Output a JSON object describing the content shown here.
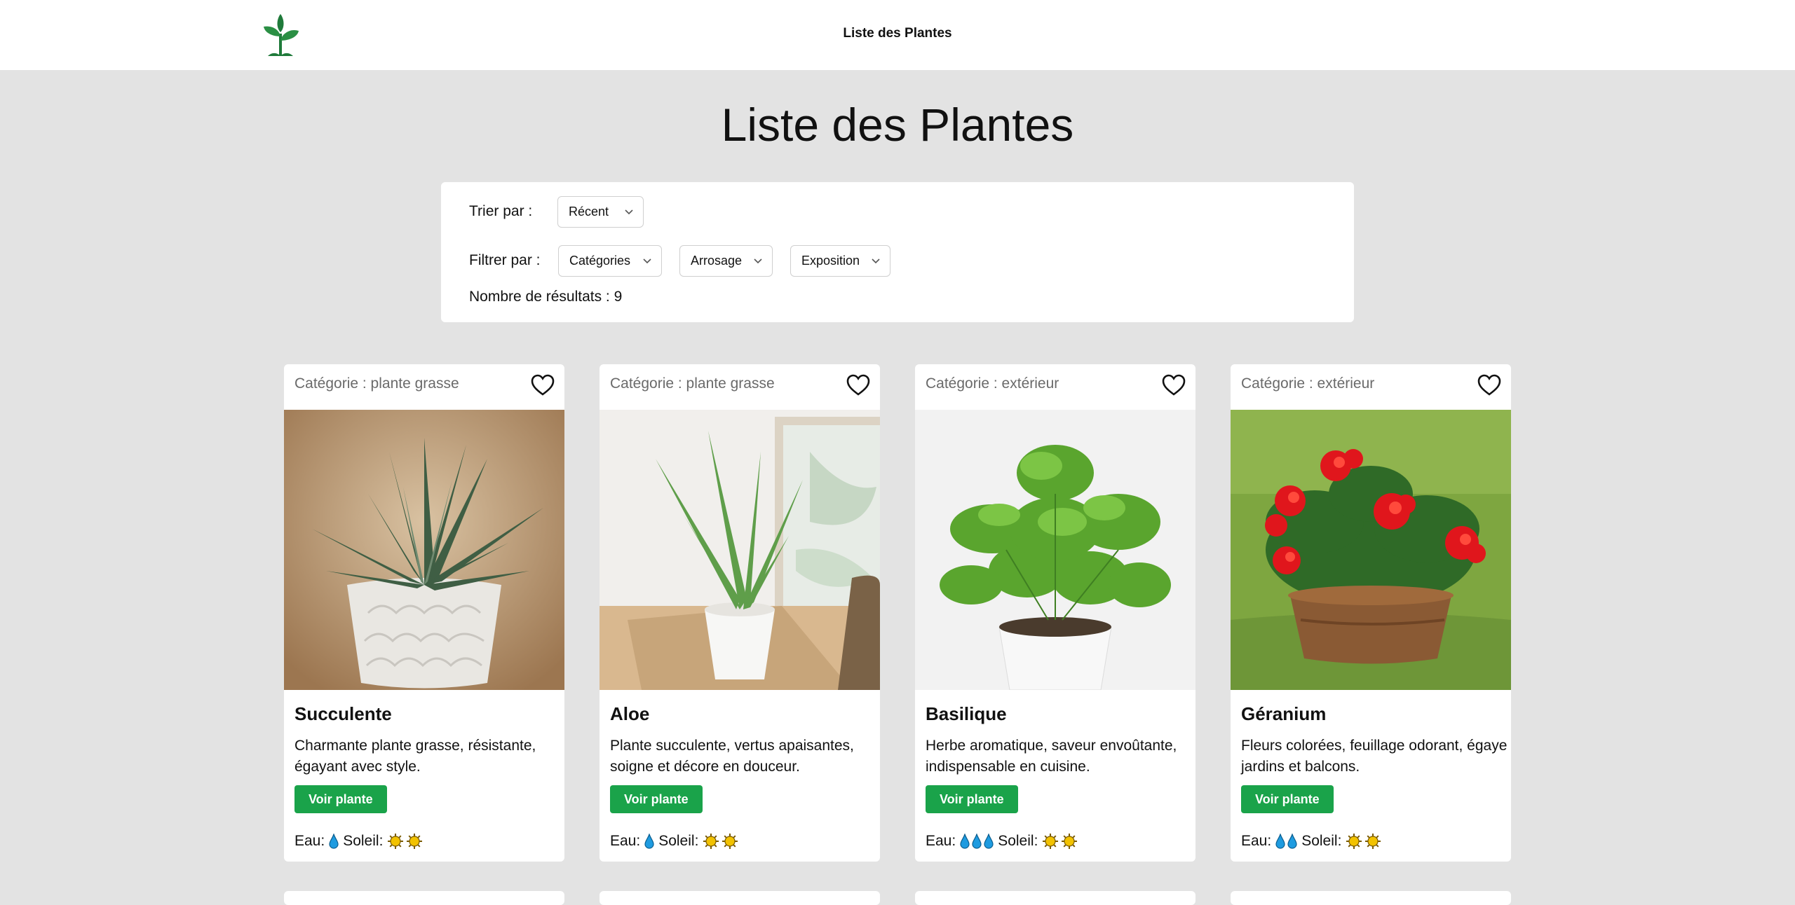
{
  "nav": {
    "link": "Liste des Plantes"
  },
  "page": {
    "title": "Liste des Plantes"
  },
  "filters": {
    "sort_label": "Trier par :",
    "sort_value": "Récent",
    "filter_label": "Filtrer par :",
    "categories": "Catégories",
    "watering": "Arrosage",
    "exposure": "Exposition",
    "results": "Nombre de résultats : 9"
  },
  "labels": {
    "water": "Eau:",
    "sun": "Soleil:",
    "view_button": "Voir plante"
  },
  "cards": [
    {
      "category": "Catégorie : plante grasse",
      "name": "Succulente",
      "description": "Charmante plante grasse, résistante, égayant avec style.",
      "water": 1,
      "sun": 2
    },
    {
      "category": "Catégorie : plante grasse",
      "name": "Aloe",
      "description": "Plante succulente, vertus apaisantes, soigne et décore en douceur.",
      "water": 1,
      "sun": 2
    },
    {
      "category": "Catégorie : extérieur",
      "name": "Basilique",
      "description": "Herbe aromatique, saveur envoûtante, indispensable en cuisine.",
      "water": 3,
      "sun": 2
    },
    {
      "category": "Catégorie : extérieur",
      "name": "Géranium",
      "description": "Fleurs colorées, feuillage odorant, égaye jardins et balcons.",
      "water": 2,
      "sun": 2
    }
  ],
  "colors": {
    "accent": "#1aa34a",
    "background": "#e3e3e3",
    "water_drop": "#1e9be0",
    "sun": "#f2c200"
  }
}
